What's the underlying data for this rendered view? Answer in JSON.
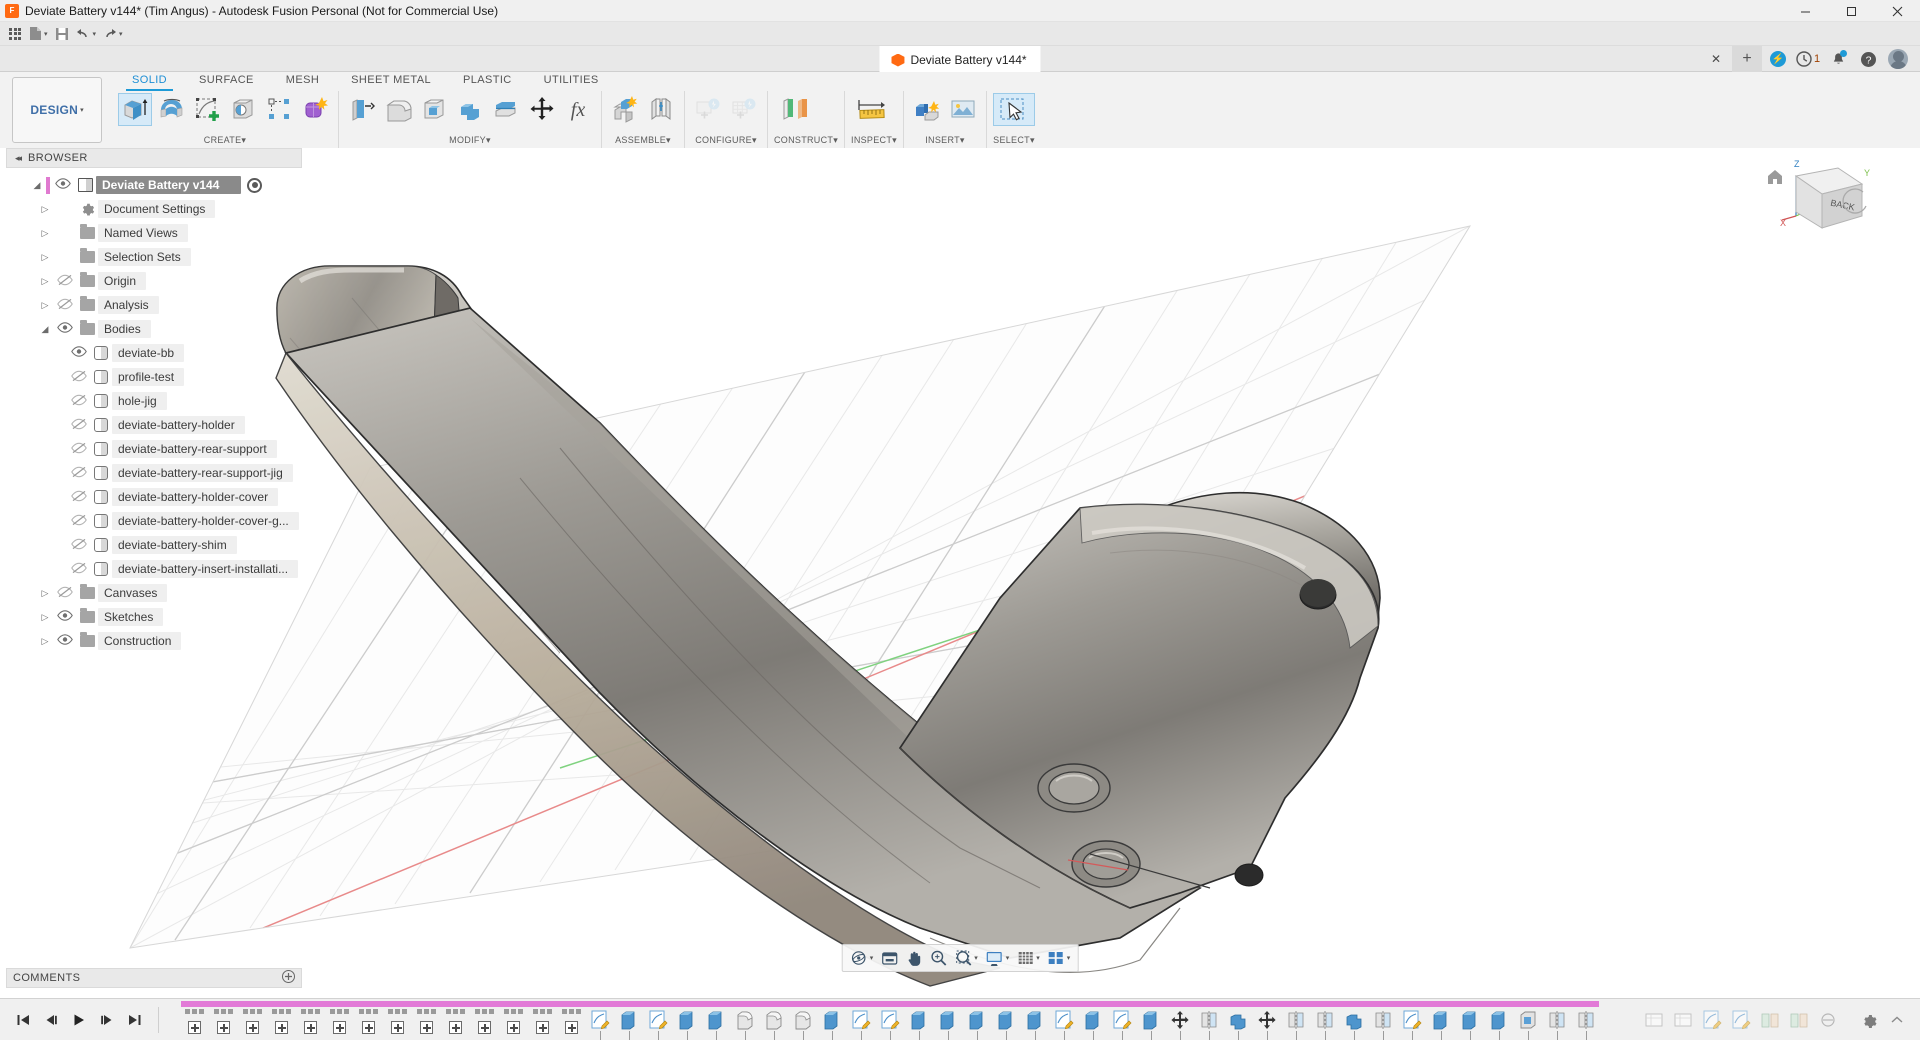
{
  "window": {
    "title": "Deviate Battery v144* (Tim Angus) - Autodesk Fusion Personal (Not for Commercial Use)",
    "app_icon": "fusion-app-icon",
    "minimize": "—",
    "maximize": "❐",
    "close": "✕"
  },
  "quick_access": {
    "app_grid": "app-grid",
    "new_file": "new-file",
    "save": "save",
    "undo": "undo",
    "redo": "redo",
    "caret": "▾"
  },
  "doc_tab": {
    "label": "Deviate Battery v144*",
    "close": "✕",
    "new_tab": "+",
    "extension_badge": "1"
  },
  "ribbon": {
    "design_label": "DESIGN",
    "design_caret": "▾",
    "tabs": [
      {
        "label": "SOLID",
        "active": true
      },
      {
        "label": "SURFACE",
        "active": false
      },
      {
        "label": "MESH",
        "active": false
      },
      {
        "label": "SHEET METAL",
        "active": false
      },
      {
        "label": "PLASTIC",
        "active": false
      },
      {
        "label": "UTILITIES",
        "active": false
      }
    ],
    "panels": [
      {
        "label": "CREATE",
        "caret": "▾",
        "tools": [
          "extrude-icon",
          "revolve-icon",
          "create-sketch-icon",
          "hole-icon",
          "pattern-icon",
          "form-icon"
        ]
      },
      {
        "label": "MODIFY",
        "caret": "▾",
        "tools": [
          "press-pull-icon",
          "fillet-icon",
          "shell-icon",
          "combine-icon",
          "offset-face-icon",
          "move-copy-icon",
          "change-parameters-icon"
        ]
      },
      {
        "label": "ASSEMBLE",
        "caret": "▾",
        "tools": [
          "new-component-icon",
          "joint-icon"
        ]
      },
      {
        "label": "CONFIGURE",
        "caret": "▾",
        "tools": [
          "configure-design-icon",
          "configure-table-icon"
        ]
      },
      {
        "label": "CONSTRUCT",
        "caret": "▾",
        "tools": [
          "offset-plane-icon"
        ]
      },
      {
        "label": "INSPECT",
        "caret": "▾",
        "tools": [
          "measure-icon"
        ]
      },
      {
        "label": "INSERT",
        "caret": "▾",
        "tools": [
          "insert-derive-icon",
          "insert-canvas-icon"
        ]
      },
      {
        "label": "SELECT",
        "caret": "▾",
        "tools": [
          "select-arrow-icon"
        ]
      }
    ]
  },
  "browser": {
    "header": "BROWSER",
    "collapse": "◂◂",
    "tree": [
      {
        "label": "Deviate Battery v144",
        "level": 0,
        "expander": "collapse",
        "eye": "visible",
        "icon": "component-icon",
        "root": true,
        "activate": "activate-radio"
      },
      {
        "label": "Document Settings",
        "level": 1,
        "expander": "expand",
        "eye": "none",
        "icon": "gear-icon"
      },
      {
        "label": "Named Views",
        "level": 1,
        "expander": "expand",
        "eye": "none",
        "icon": "folder-icon"
      },
      {
        "label": "Selection Sets",
        "level": 1,
        "expander": "expand",
        "eye": "none",
        "icon": "folder-icon"
      },
      {
        "label": "Origin",
        "level": 1,
        "expander": "expand",
        "eye": "hidden",
        "icon": "folder-icon"
      },
      {
        "label": "Analysis",
        "level": 1,
        "expander": "expand",
        "eye": "hidden",
        "icon": "folder-icon"
      },
      {
        "label": "Bodies",
        "level": 1,
        "expander": "collapse",
        "eye": "visible",
        "icon": "folder-icon"
      },
      {
        "label": "deviate-bb",
        "level": 2,
        "expander": "none",
        "eye": "visible",
        "icon": "body-icon"
      },
      {
        "label": "profile-test",
        "level": 2,
        "expander": "none",
        "eye": "hidden",
        "icon": "body-icon"
      },
      {
        "label": "hole-jig",
        "level": 2,
        "expander": "none",
        "eye": "hidden",
        "icon": "body-icon"
      },
      {
        "label": "deviate-battery-holder",
        "level": 2,
        "expander": "none",
        "eye": "hidden",
        "icon": "body-icon"
      },
      {
        "label": "deviate-battery-rear-support",
        "level": 2,
        "expander": "none",
        "eye": "hidden",
        "icon": "body-icon"
      },
      {
        "label": "deviate-battery-rear-support-jig",
        "level": 2,
        "expander": "none",
        "eye": "hidden",
        "icon": "body-icon"
      },
      {
        "label": "deviate-battery-holder-cover",
        "level": 2,
        "expander": "none",
        "eye": "hidden",
        "icon": "body-icon"
      },
      {
        "label": "deviate-battery-holder-cover-g...",
        "level": 2,
        "expander": "none",
        "eye": "hidden",
        "icon": "body-icon"
      },
      {
        "label": "deviate-battery-shim",
        "level": 2,
        "expander": "none",
        "eye": "hidden",
        "icon": "body-icon"
      },
      {
        "label": "deviate-battery-insert-installati...",
        "level": 2,
        "expander": "none",
        "eye": "hidden",
        "icon": "body-icon"
      },
      {
        "label": "Canvases",
        "level": 1,
        "expander": "expand",
        "eye": "hidden",
        "icon": "folder-icon"
      },
      {
        "label": "Sketches",
        "level": 1,
        "expander": "expand",
        "eye": "visible",
        "icon": "folder-icon"
      },
      {
        "label": "Construction",
        "level": 1,
        "expander": "expand",
        "eye": "visible",
        "icon": "folder-icon"
      }
    ]
  },
  "comments": {
    "label": "COMMENTS",
    "add": "+"
  },
  "viewcube": {
    "face_label": "BACK",
    "axis_x": "X",
    "axis_y": "Y",
    "axis_z": "Z",
    "home_icon": "home-icon"
  },
  "navbar": {
    "buttons": [
      {
        "name": "orbit-icon",
        "caret": "▾"
      },
      {
        "name": "display-settings-icon",
        "caret": ""
      },
      {
        "name": "pan-icon",
        "caret": ""
      },
      {
        "name": "zoom-icon",
        "caret": ""
      },
      {
        "name": "fit-icon",
        "caret": "▾"
      },
      {
        "name": "display-mode-icon",
        "caret": "▾"
      },
      {
        "name": "grid-snap-icon",
        "caret": "▾"
      },
      {
        "name": "viewports-icon",
        "caret": "▾"
      }
    ]
  },
  "timeline": {
    "playback": [
      {
        "name": "go-to-beginning-button",
        "glyph": "⏮"
      },
      {
        "name": "step-back-button",
        "glyph": "◀❘"
      },
      {
        "name": "play-button",
        "glyph": "▶"
      },
      {
        "name": "step-forward-button",
        "glyph": "❘▶"
      },
      {
        "name": "go-to-end-button",
        "glyph": "⏭"
      }
    ],
    "collapsed_groups": 14,
    "features": [
      "sketch-feature",
      "extrude-feature",
      "sketch-feature",
      "extrude-feature",
      "extrude-feature",
      "fillet-feature",
      "fillet-feature",
      "fillet-feature",
      "extrude-feature",
      "sketch-feature",
      "sketch-feature",
      "extrude-feature",
      "extrude-feature",
      "extrude-feature",
      "extrude-feature",
      "extrude-feature",
      "sketch-feature",
      "extrude-feature",
      "sketch-feature",
      "extrude-feature",
      "move-feature",
      "pattern-feature",
      "combine-feature",
      "move-feature",
      "pattern-feature",
      "pattern-feature",
      "combine-feature",
      "pattern-feature",
      "sketch-feature",
      "extrude-feature",
      "extrude-feature",
      "body-feature",
      "shell-feature",
      "mirror-feature",
      "mirror-feature"
    ],
    "right_features": [
      "rect-feature",
      "rect-feature",
      "sketch-feature",
      "sketch-feature",
      "plane-feature",
      "plane-feature",
      "link-feature"
    ],
    "settings_icon": "timeline-settings-icon",
    "scroll_up_icon": "⌃"
  },
  "colors": {
    "accent": "#1e9ad6",
    "brand_orange": "#ff6a13",
    "timeline_progress": "#e27ad7",
    "panel_bg": "#f0f0f0",
    "selection": "#8a8a8a"
  }
}
